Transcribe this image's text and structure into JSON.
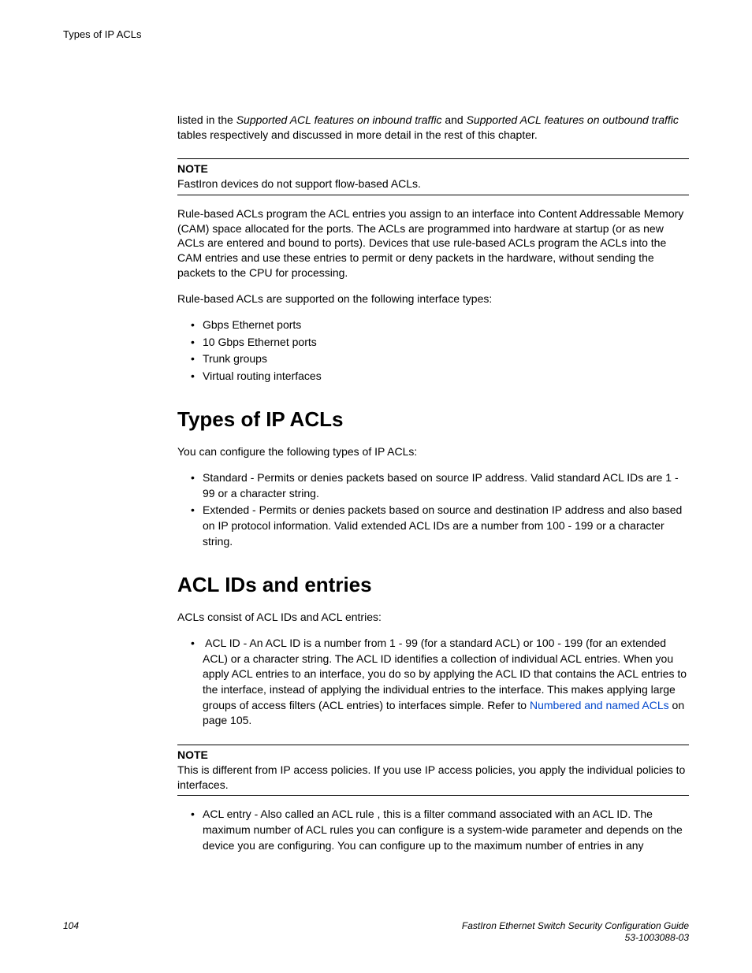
{
  "header": {
    "section_label": "Types of IP ACLs"
  },
  "intro": {
    "para1_pre": "listed in the ",
    "para1_it1": "Supported ACL features on inbound traffic",
    "para1_mid": " and ",
    "para1_it2": "Supported ACL features on outbound traffic",
    "para1_post": " tables respectively and discussed in more detail in the rest of this chapter."
  },
  "note1": {
    "label": "NOTE",
    "text": "FastIron devices do not support flow-based ACLs."
  },
  "body": {
    "p2": "Rule-based ACLs program the ACL entries you assign to an interface into Content Addressable Memory (CAM) space allocated for the ports. The ACLs are programmed into hardware at startup (or as new ACLs are entered and bound to ports). Devices that use rule-based ACLs program the ACLs into the CAM entries and use these entries to permit or deny packets in the hardware, without sending the packets to the CPU for processing.",
    "p3": "Rule-based ACLs are supported on the following interface types:",
    "list1": [
      "Gbps Ethernet ports",
      "10 Gbps Ethernet ports",
      "Trunk groups",
      "Virtual routing interfaces"
    ]
  },
  "sec_types": {
    "heading": "Types of IP ACLs",
    "p1": "You can configure the following types of IP ACLs:",
    "list": [
      "Standard - Permits or denies packets based on source IP address. Valid standard ACL IDs are 1 - 99 or a character string.",
      "Extended - Permits or denies packets based on source and destination IP address and also based on IP protocol information. Valid extended ACL IDs are a number from 100 - 199 or a character string."
    ]
  },
  "sec_ids": {
    "heading": "ACL IDs and entries",
    "p1": "ACLs consist of ACL IDs and ACL entries:",
    "item1_pre": "ACL ID - An ACL ID is a number from 1 - 99 (for a standard ACL) or 100 - 199 (for an extended ACL) or a character string. The ACL ID identifies a collection of individual ACL entries. When you apply ACL entries to an interface, you do so by applying the ACL ID that contains the ACL entries to the interface, instead of applying the individual entries to the interface. This makes applying large groups of access filters (ACL entries) to interfaces simple. Refer to ",
    "item1_link": "Numbered and named ACLs",
    "item1_post": " on page 105.",
    "note": {
      "label": "NOTE",
      "text": "This is different from IP access policies. If you use IP access policies, you apply the individual policies to interfaces."
    },
    "item2": "ACL entry - Also called an ACL rule , this is a filter command associated with an ACL ID. The maximum number of ACL rules you can configure is a system-wide parameter and depends on the device you are configuring. You can configure up to the maximum number of entries in any"
  },
  "footer": {
    "page": "104",
    "guide_line1": "FastIron Ethernet Switch Security Configuration Guide",
    "guide_line2": "53-1003088-03"
  }
}
